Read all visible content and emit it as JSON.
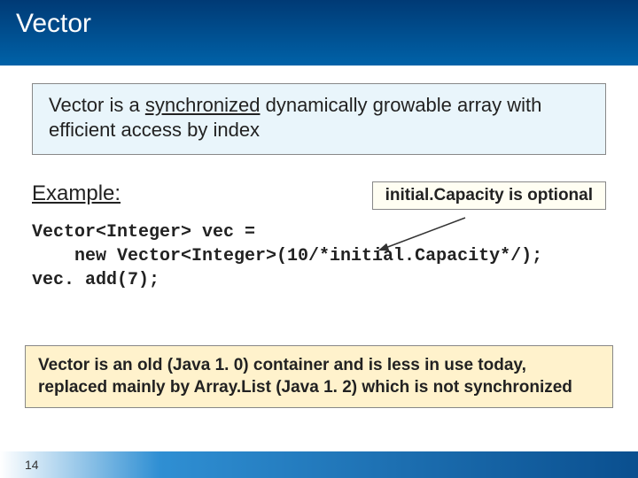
{
  "header": {
    "title": "Vector"
  },
  "description": {
    "prefix": "Vector is a ",
    "underlined": "synchronized",
    "suffix": " dynamically growable array with efficient access by index"
  },
  "example": {
    "label": "Example:",
    "callout": "initial.Capacity is optional"
  },
  "code": {
    "line1": "Vector<Integer> vec =",
    "line2": "new Vector<Integer>(10/*initial.Capacity*/);",
    "line3": "vec. add(7);"
  },
  "note": {
    "text": "Vector is an old (Java 1. 0) container and is less in use today, replaced mainly by Array.List (Java 1. 2) which is not synchronized"
  },
  "footer": {
    "page": "14"
  }
}
